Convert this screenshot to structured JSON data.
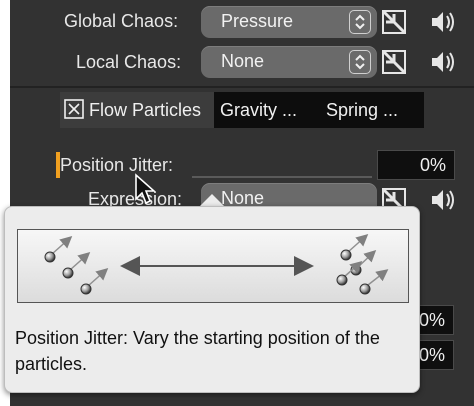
{
  "rows": {
    "global_chaos": {
      "label": "Global Chaos:",
      "value": "Pressure"
    },
    "local_chaos": {
      "label": "Local Chaos:",
      "value": "None"
    }
  },
  "tabs": [
    {
      "label": "Flow Particles"
    },
    {
      "label": "Gravity ..."
    },
    {
      "label": "Spring ..."
    }
  ],
  "position_jitter": {
    "label": "Position Jitter:",
    "value": "0%"
  },
  "expression": {
    "label": "Expression:",
    "value": "None"
  },
  "hidden_fields": {
    "field_a": "0%",
    "field_b": "0%"
  },
  "tooltip": {
    "text": "Position Jitter: Vary the starting position of the particles."
  },
  "colors": {
    "panel": "#323232",
    "accent": "#f0a020"
  }
}
